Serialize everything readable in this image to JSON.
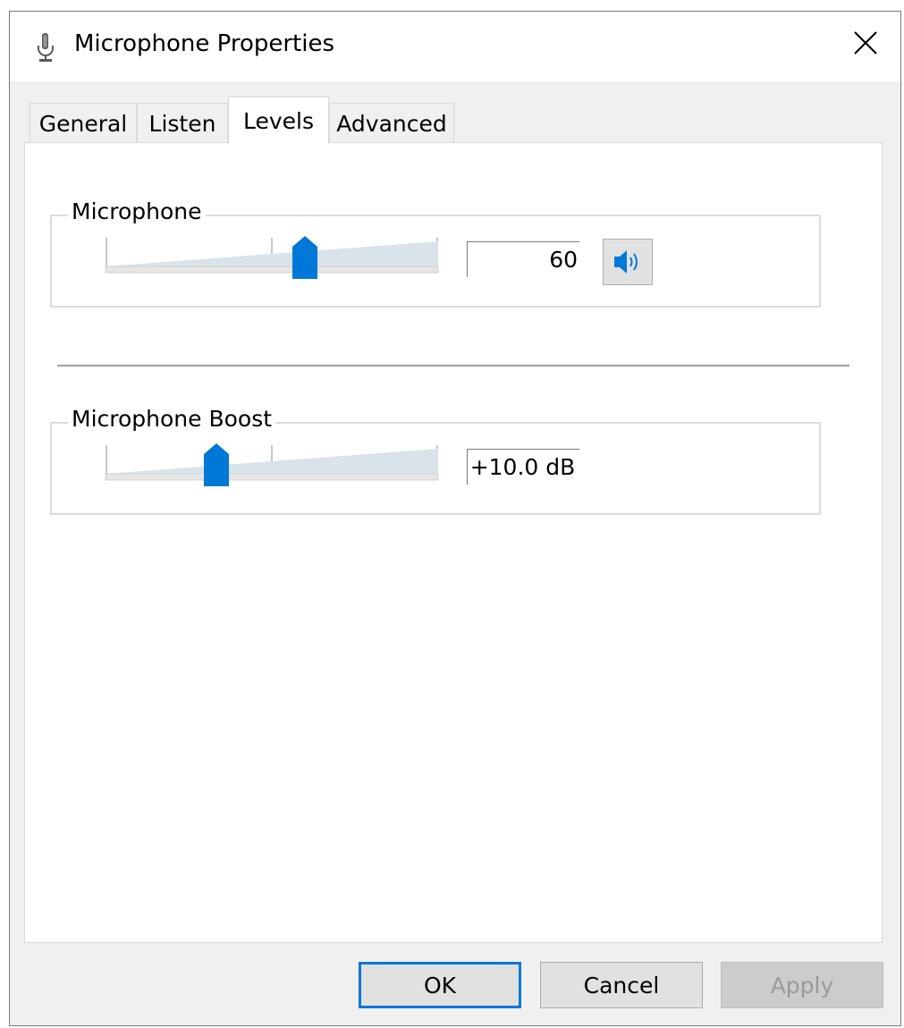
{
  "window": {
    "title": "Microphone Properties",
    "icon": "microphone-icon",
    "close_icon": "close-icon"
  },
  "tabs": [
    {
      "label": "General",
      "active": false
    },
    {
      "label": "Listen",
      "active": false
    },
    {
      "label": "Levels",
      "active": true
    },
    {
      "label": "Advanced",
      "active": false
    }
  ],
  "levels": {
    "microphone": {
      "label": "Microphone",
      "value": "60",
      "level_fraction": 0.6,
      "mute_icon": "speaker-icon"
    },
    "boost": {
      "label": "Microphone Boost",
      "value": "+10.0 dB",
      "level_fraction": 0.333
    }
  },
  "buttons": {
    "ok": "OK",
    "cancel": "Cancel",
    "apply": "Apply"
  },
  "colors": {
    "accent": "#0078d7",
    "slider_fill": "#d9e3ea"
  }
}
